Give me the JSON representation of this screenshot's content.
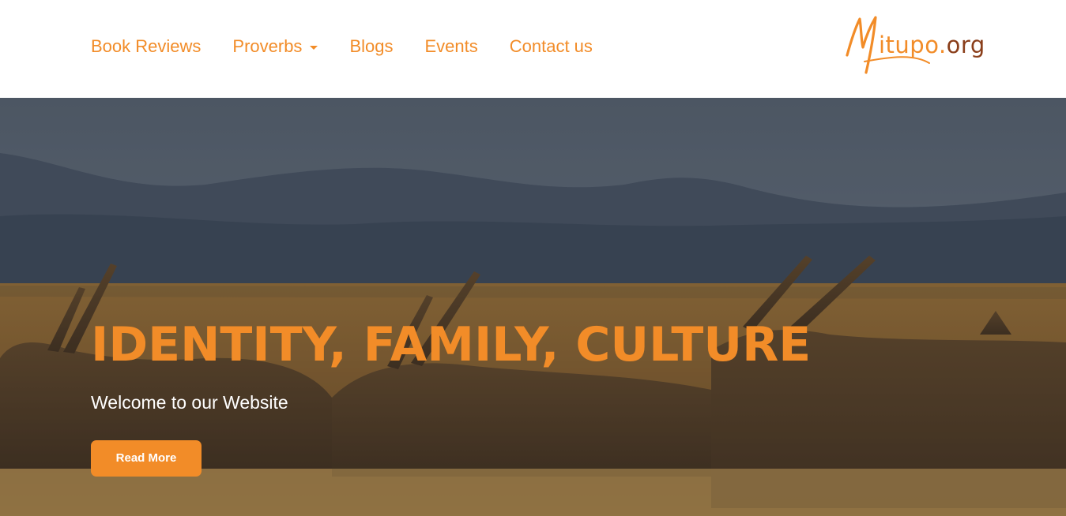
{
  "nav": {
    "items": [
      {
        "label": "Book Reviews"
      },
      {
        "label": "Proverbs"
      },
      {
        "label": "Blogs"
      },
      {
        "label": "Events"
      },
      {
        "label": "Contact us"
      }
    ]
  },
  "logo": {
    "m": "M",
    "name": "itupo",
    "dot": ".",
    "tld": "org"
  },
  "hero": {
    "title": "IDENTITY, FAMILY, CULTURE",
    "subtitle": "Welcome to our Website",
    "button_label": "Read More"
  },
  "colors": {
    "accent": "#f28c28",
    "logo_tld": "#8a3e1a"
  }
}
